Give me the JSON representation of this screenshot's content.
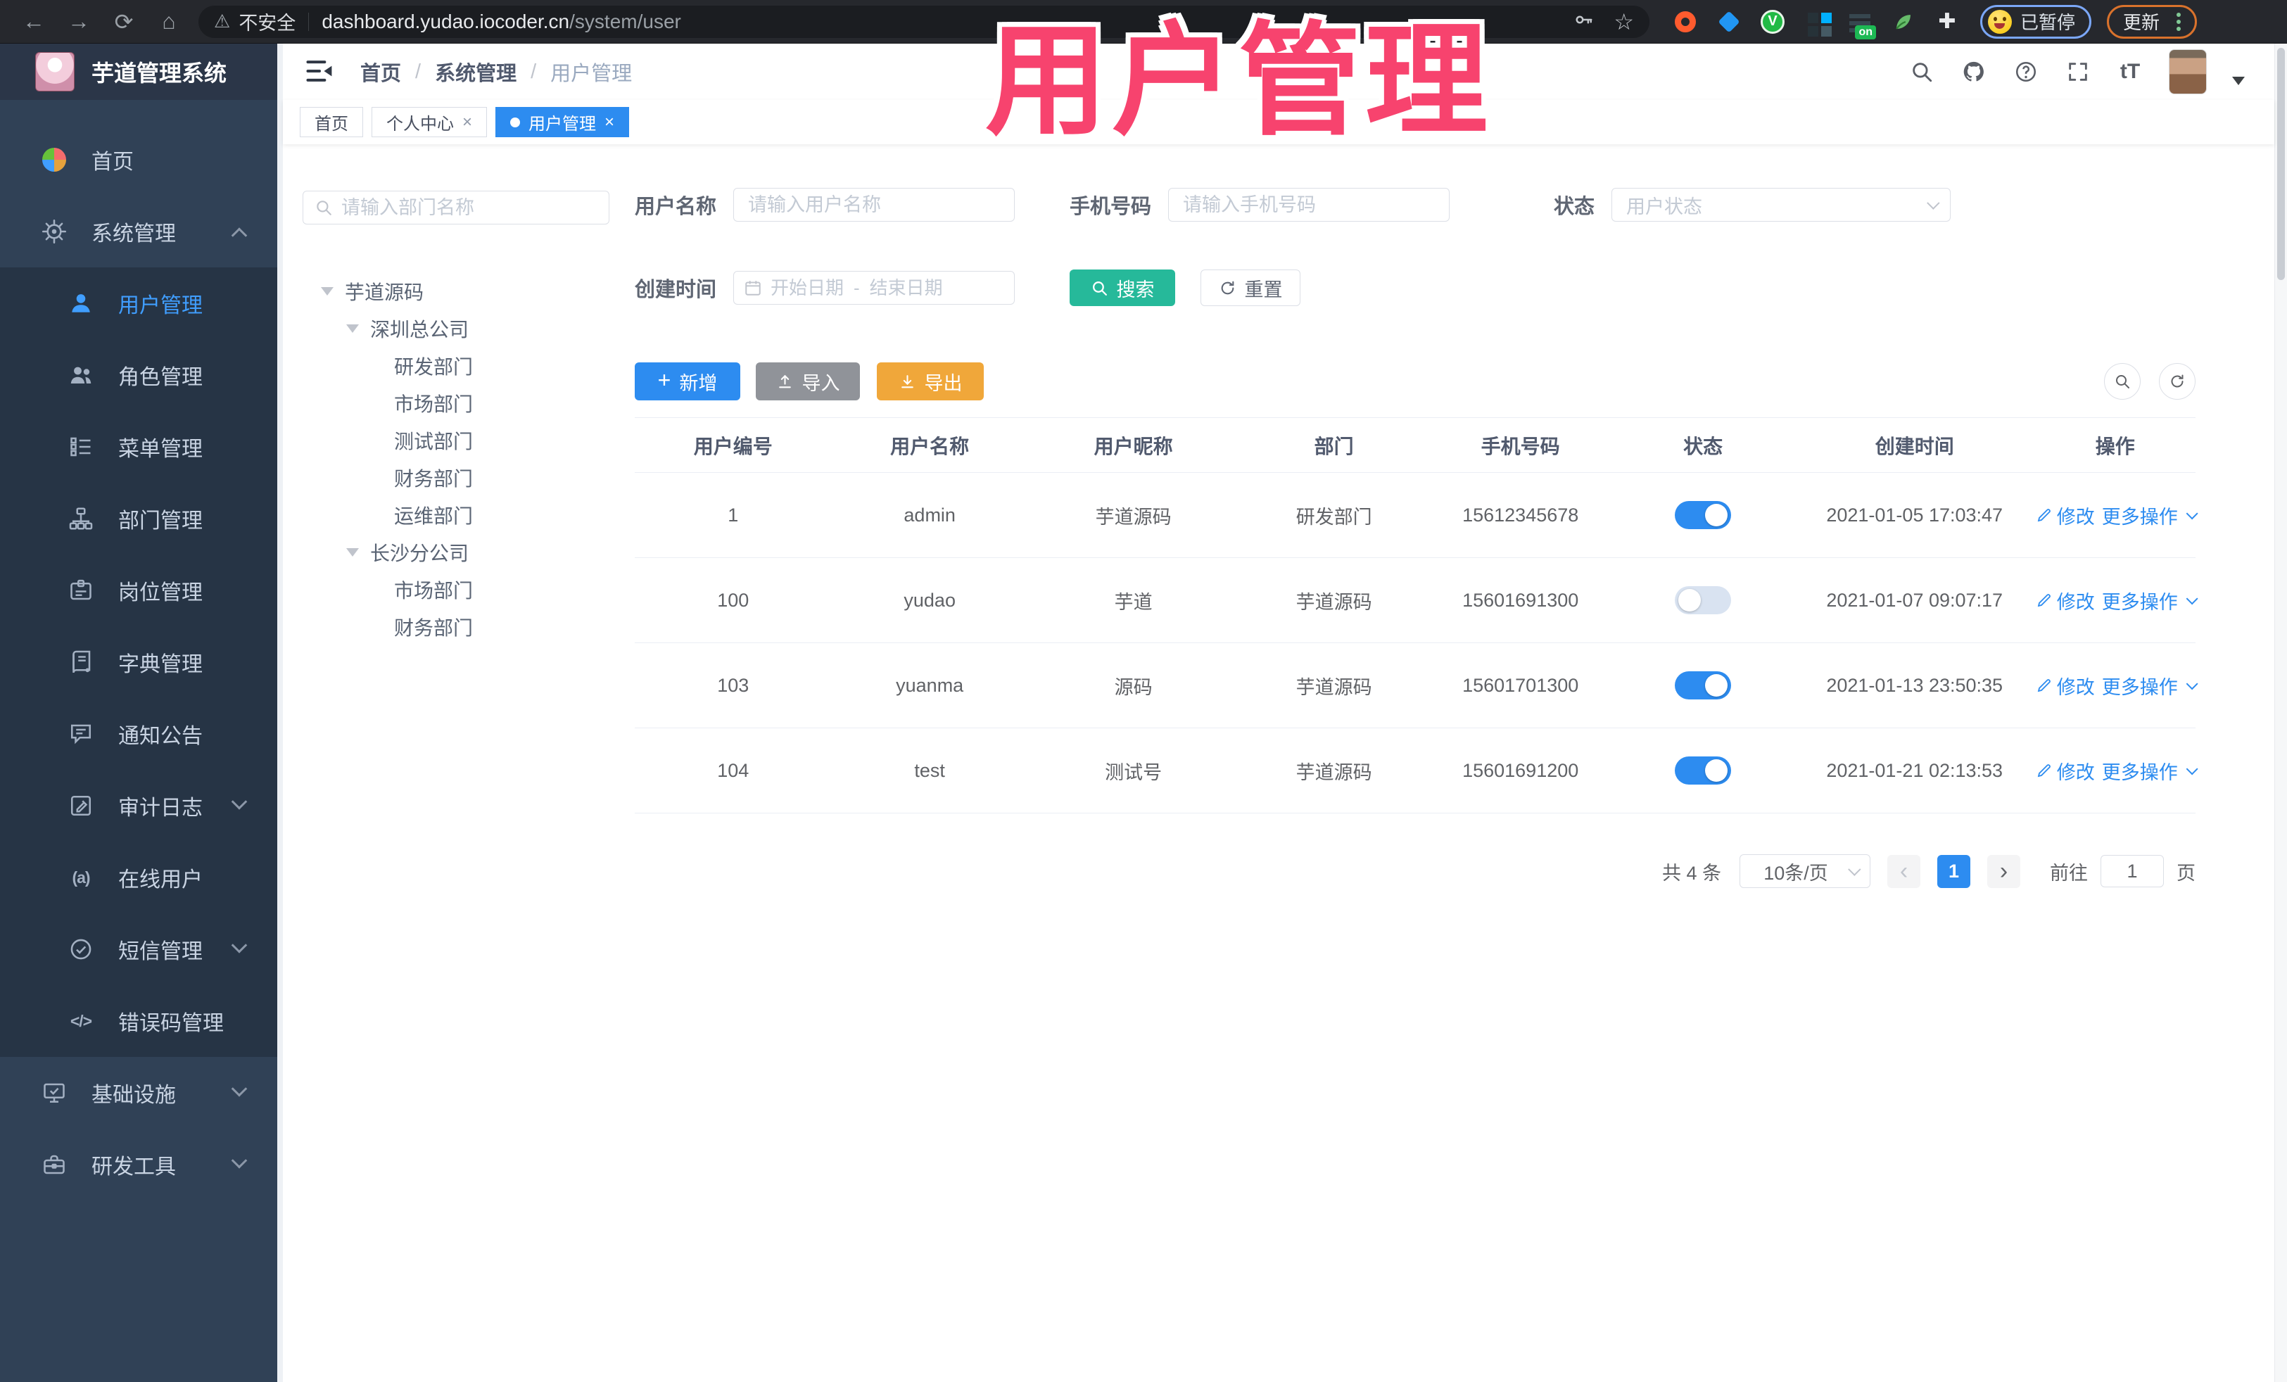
{
  "browser": {
    "security_label": "不安全",
    "url_domain": "dashboard.yudao.iocoder.cn",
    "url_path": "/system/user",
    "paused_label": "已暂停",
    "update_label": "更新",
    "on_badge": "on"
  },
  "icons": {
    "back": "←",
    "forward": "→",
    "reload": "⟳",
    "home": "⌂",
    "warning": "⚠",
    "star": "☆",
    "close": "×",
    "plus": "+",
    "prev": "‹",
    "next": "›",
    "online": "(a)",
    "code": "</>",
    "font_size": "tT",
    "puzzle": "✚",
    "green_ext": "V"
  },
  "app": {
    "logo_title": "芋道管理系统",
    "breadcrumb": {
      "item1": "首页",
      "item2": "系统管理",
      "item3": "用户管理",
      "sep": "/"
    }
  },
  "overlay_title": "用户管理",
  "tabs": {
    "tab1": "首页",
    "tab2": "个人中心",
    "tab3": "用户管理"
  },
  "sidebar": {
    "items": [
      {
        "label": "首页"
      },
      {
        "label": "系统管理"
      },
      {
        "label": "用户管理"
      },
      {
        "label": "角色管理"
      },
      {
        "label": "菜单管理"
      },
      {
        "label": "部门管理"
      },
      {
        "label": "岗位管理"
      },
      {
        "label": "字典管理"
      },
      {
        "label": "通知公告"
      },
      {
        "label": "审计日志"
      },
      {
        "label": "在线用户"
      },
      {
        "label": "短信管理"
      },
      {
        "label": "错误码管理"
      },
      {
        "label": "基础设施"
      },
      {
        "label": "研发工具"
      }
    ]
  },
  "tree": {
    "search_placeholder": "请输入部门名称",
    "nodes": [
      {
        "label": "芋道源码"
      },
      {
        "label": "深圳总公司"
      },
      {
        "label": "研发部门"
      },
      {
        "label": "市场部门"
      },
      {
        "label": "测试部门"
      },
      {
        "label": "财务部门"
      },
      {
        "label": "运维部门"
      },
      {
        "label": "长沙分公司"
      },
      {
        "label": "市场部门"
      },
      {
        "label": "财务部门"
      }
    ]
  },
  "filters": {
    "username_label": "用户名称",
    "username_placeholder": "请输入用户名称",
    "mobile_label": "手机号码",
    "mobile_placeholder": "请输入手机号码",
    "status_label": "状态",
    "status_placeholder": "用户状态",
    "create_time_label": "创建时间",
    "date_start_placeholder": "开始日期",
    "date_separator": "-",
    "date_end_placeholder": "结束日期",
    "search_label": "搜索",
    "reset_label": "重置"
  },
  "toolbar": {
    "add_label": "新增",
    "import_label": "导入",
    "export_label": "导出"
  },
  "table": {
    "columns": [
      "用户编号",
      "用户名称",
      "用户昵称",
      "部门",
      "手机号码",
      "状态",
      "创建时间",
      "操作"
    ],
    "edit_label": "修改",
    "more_label": "更多操作",
    "rows": [
      {
        "id": "1",
        "username": "admin",
        "nickname": "芋道源码",
        "dept": "研发部门",
        "mobile": "15612345678",
        "status_on": true,
        "created": "2021-01-05 17:03:47"
      },
      {
        "id": "100",
        "username": "yudao",
        "nickname": "芋道",
        "dept": "芋道源码",
        "mobile": "15601691300",
        "status_on": false,
        "created": "2021-01-07 09:07:17"
      },
      {
        "id": "103",
        "username": "yuanma",
        "nickname": "源码",
        "dept": "芋道源码",
        "mobile": "15601701300",
        "status_on": true,
        "created": "2021-01-13 23:50:35"
      },
      {
        "id": "104",
        "username": "test",
        "nickname": "测试号",
        "dept": "芋道源码",
        "mobile": "15601691200",
        "status_on": true,
        "created": "2021-01-21 02:13:53"
      }
    ]
  },
  "pagination": {
    "total_label": "共 4 条",
    "page_size_label": "10条/页",
    "current_page": "1",
    "goto_label": "前往",
    "goto_value": "1",
    "page_unit": "页"
  },
  "colors": {
    "primary": "#2d8cf0",
    "menu_active": "#409eff",
    "search_button": "#26b99a",
    "export_button": "#f0a73a",
    "import_button": "#909399",
    "overlay_pink": "#f7436e",
    "sidebar_bg": "#304156",
    "submenu_bg": "#263445"
  }
}
